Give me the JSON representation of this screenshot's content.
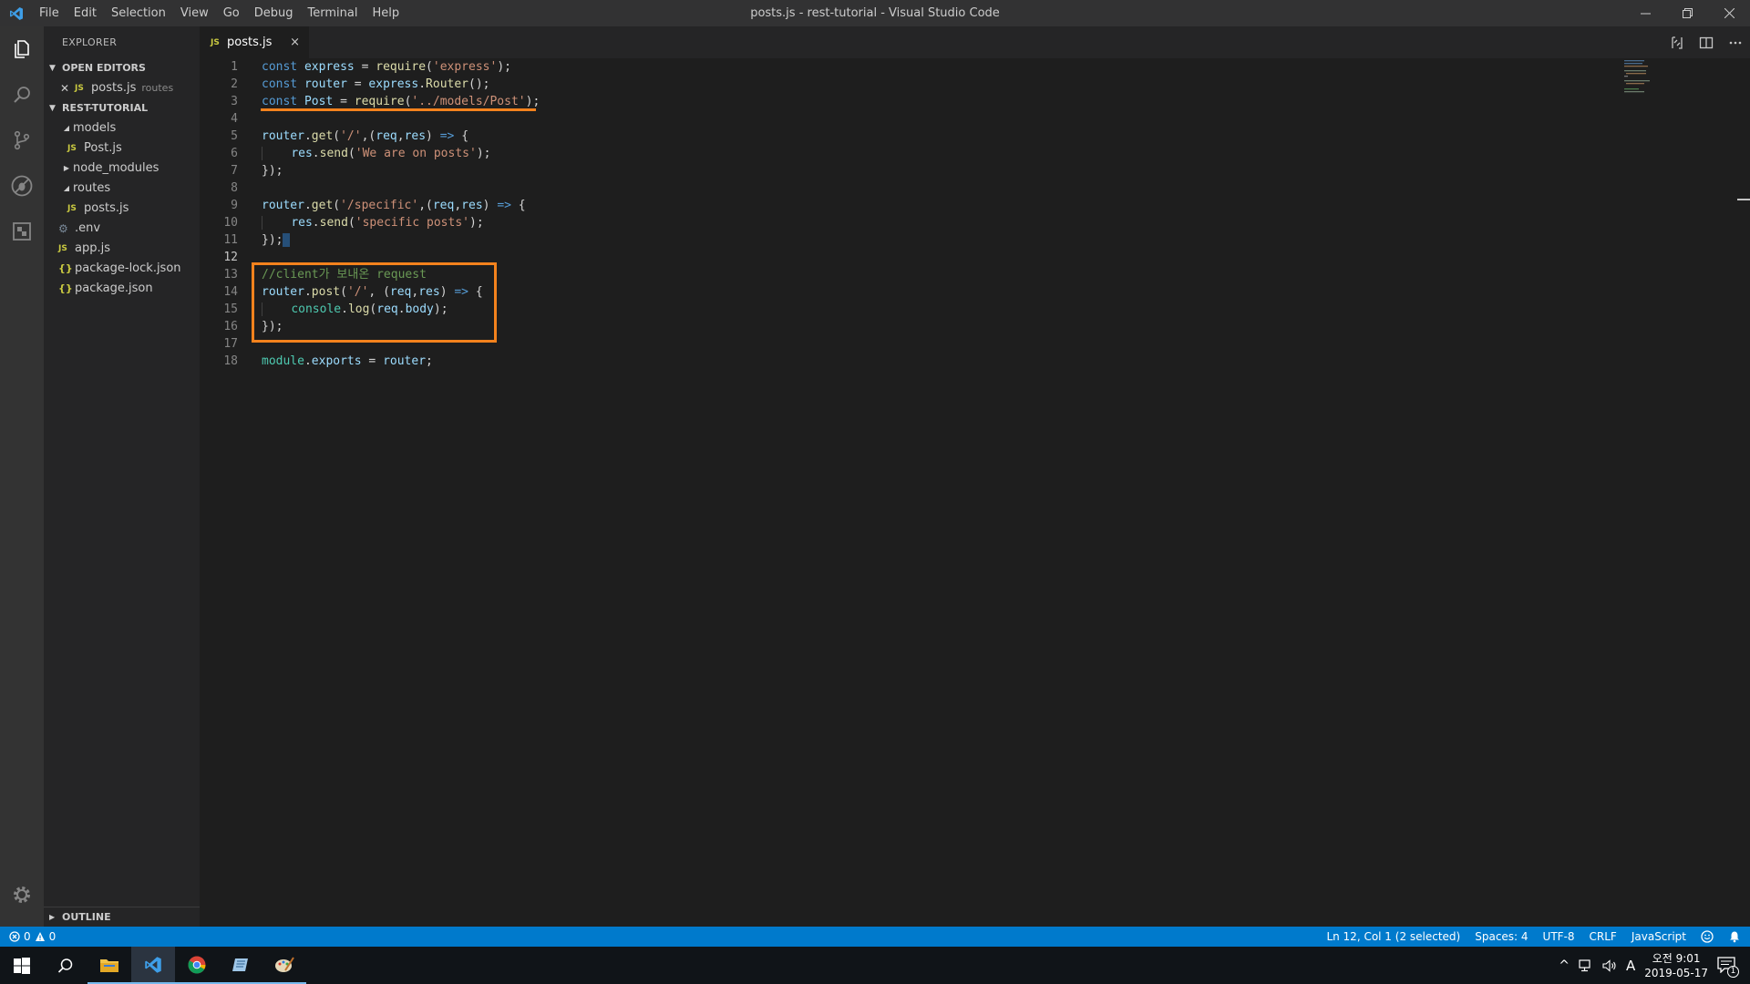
{
  "window": {
    "title": "posts.js - rest-tutorial - Visual Studio Code",
    "menu": [
      "File",
      "Edit",
      "Selection",
      "View",
      "Go",
      "Debug",
      "Terminal",
      "Help"
    ]
  },
  "sidebar": {
    "title": "EXPLORER",
    "open_editors_label": "OPEN EDITORS",
    "open_editor": {
      "name": "posts.js",
      "folder": "routes"
    },
    "project_label": "REST-TUTORIAL",
    "tree": [
      {
        "name": "models",
        "kind": "folder",
        "expanded": true,
        "depth": 1
      },
      {
        "name": "Post.js",
        "kind": "js",
        "depth": 2
      },
      {
        "name": "node_modules",
        "kind": "folder",
        "expanded": false,
        "depth": 1
      },
      {
        "name": "routes",
        "kind": "folder",
        "expanded": true,
        "depth": 1
      },
      {
        "name": "posts.js",
        "kind": "js",
        "depth": 2
      },
      {
        "name": ".env",
        "kind": "env",
        "depth": 1
      },
      {
        "name": "app.js",
        "kind": "js",
        "depth": 1
      },
      {
        "name": "package-lock.json",
        "kind": "json",
        "depth": 1
      },
      {
        "name": "package.json",
        "kind": "json",
        "depth": 1
      }
    ],
    "outline_label": "OUTLINE"
  },
  "tab": {
    "label": "posts.js",
    "close": "×"
  },
  "editor": {
    "active_line": 12,
    "line_numbers": [
      "1",
      "2",
      "3",
      "4",
      "5",
      "6",
      "7",
      "8",
      "9",
      "10",
      "11",
      "12",
      "13",
      "14",
      "15",
      "16",
      "17",
      "18"
    ]
  },
  "status": {
    "errors": "0",
    "warnings": "0",
    "position": "Ln 12, Col 1 (2 selected)",
    "spaces": "Spaces: 4",
    "encoding": "UTF-8",
    "eol": "CRLF",
    "language": "JavaScript"
  },
  "taskbar": {
    "time": "오전 9:01",
    "date": "2019-05-17",
    "ime": "A",
    "notifications": "1"
  },
  "colors": {
    "accent": "#007acc",
    "annotation": "#f3821d",
    "keyword": "#569cd6",
    "string": "#ce9178",
    "comment": "#6a9955"
  }
}
